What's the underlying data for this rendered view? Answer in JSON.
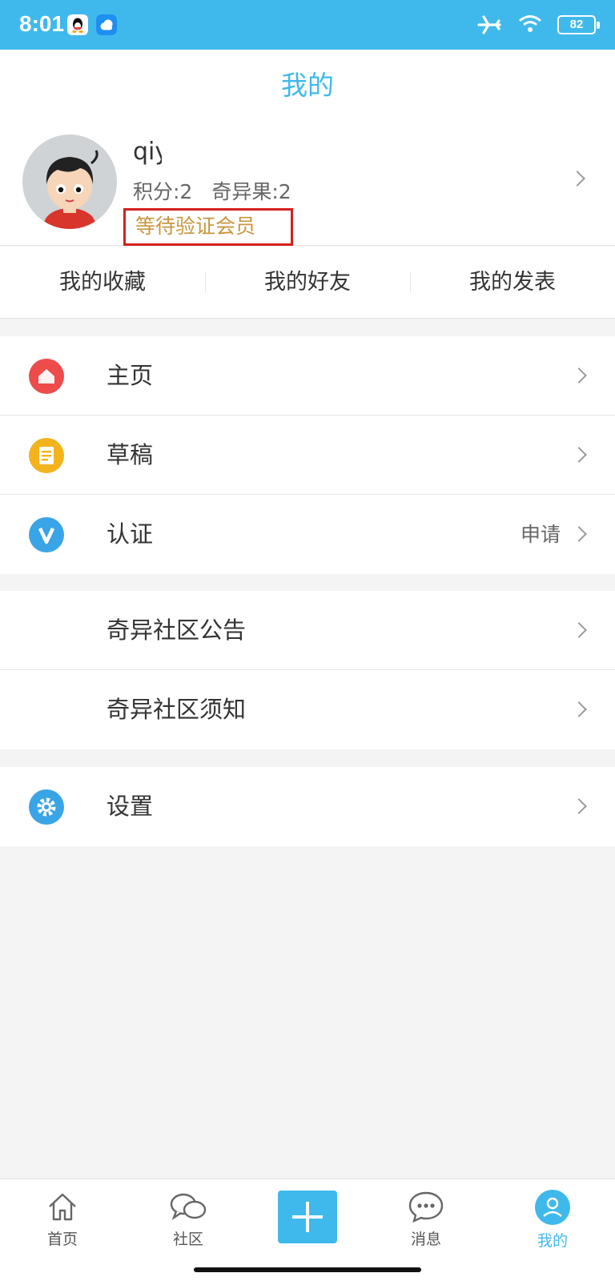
{
  "status_bar": {
    "time": "8:01",
    "battery": "82",
    "icons": [
      "qq-icon",
      "cloud-icon",
      "airplane-mode-icon",
      "wifi-icon",
      "battery-icon"
    ]
  },
  "header": {
    "title": "我的"
  },
  "profile": {
    "username": "qiy",
    "points_label": "积分:2",
    "fruit_label": "奇异果:2",
    "member_status": "等待验证会员"
  },
  "quick_links": [
    "我的收藏",
    "我的好友",
    "我的发表"
  ],
  "menu_group_1": [
    {
      "label": "主页",
      "icon": "home-icon",
      "icon_color": "#ee4b4b"
    },
    {
      "label": "草稿",
      "icon": "draft-icon",
      "icon_color": "#f3b31c"
    },
    {
      "label": "认证",
      "icon": "verify-icon",
      "icon_color": "#3aa5e6",
      "value": "申请"
    }
  ],
  "menu_group_2": [
    {
      "label": "奇异社区公告"
    },
    {
      "label": "奇异社区须知"
    }
  ],
  "menu_group_3": [
    {
      "label": "设置",
      "icon": "settings-icon",
      "icon_color": "#3aa5e6"
    }
  ],
  "tab_bar": {
    "tabs": [
      {
        "label": "首页",
        "icon": "home-outline-icon"
      },
      {
        "label": "社区",
        "icon": "chat-bubbles-icon"
      },
      {
        "label": "",
        "icon": "plus-icon"
      },
      {
        "label": "消息",
        "icon": "message-icon"
      },
      {
        "label": "我的",
        "icon": "profile-icon"
      }
    ]
  },
  "colors": {
    "accent": "#3fb9ec",
    "highlight_border": "#d42020",
    "member_text": "#c8963e"
  }
}
